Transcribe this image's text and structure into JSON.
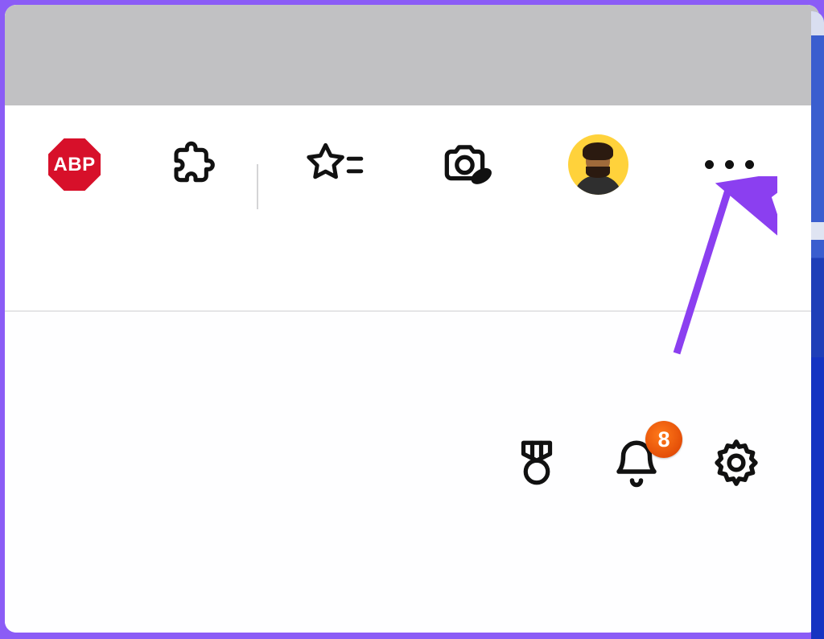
{
  "browser_toolbar": {
    "abp": {
      "label": "ABP",
      "accent": "#d7102a"
    },
    "extensions": {
      "name": "extensions-icon"
    },
    "favorites": {
      "name": "favorites-star-icon"
    },
    "screenshot": {
      "name": "screenshot-camera-icon"
    },
    "profile": {
      "name": "profile-avatar"
    },
    "menu": {
      "name": "more-menu-icon"
    }
  },
  "page_toolbar": {
    "rewards": {
      "name": "medal-icon"
    },
    "notifications": {
      "name": "bell-icon",
      "badge_count": "8",
      "badge_color": "#f05a1a"
    },
    "settings": {
      "name": "gear-icon"
    }
  },
  "annotation": {
    "arrow_color": "#8b3ff0",
    "points_to": "more-menu"
  }
}
